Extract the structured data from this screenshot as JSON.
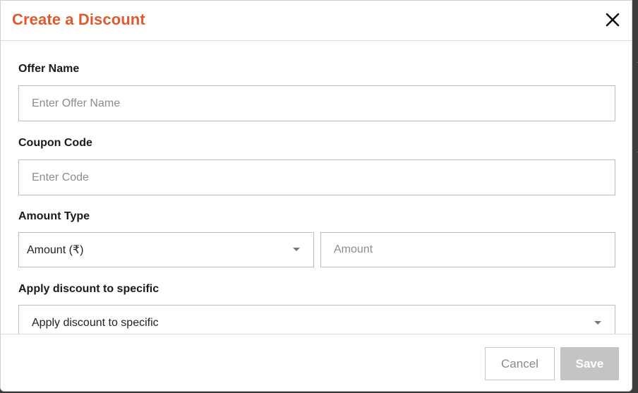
{
  "modal": {
    "title": "Create a Discount",
    "close_icon": "close-icon"
  },
  "form": {
    "offer_name": {
      "label": "Offer Name",
      "placeholder": "Enter Offer Name",
      "value": ""
    },
    "coupon_code": {
      "label": "Coupon Code",
      "placeholder": "Enter Code",
      "value": ""
    },
    "amount_type": {
      "label": "Amount Type",
      "selected": "Amount (₹)",
      "amount_placeholder": "Amount",
      "amount_value": ""
    },
    "apply_specific": {
      "label": "Apply discount to specific",
      "selected": "Apply discount to specific"
    }
  },
  "footer": {
    "cancel_label": "Cancel",
    "save_label": "Save"
  },
  "colors": {
    "title": "#e05a2b",
    "save_disabled": "#c4c4c4"
  }
}
